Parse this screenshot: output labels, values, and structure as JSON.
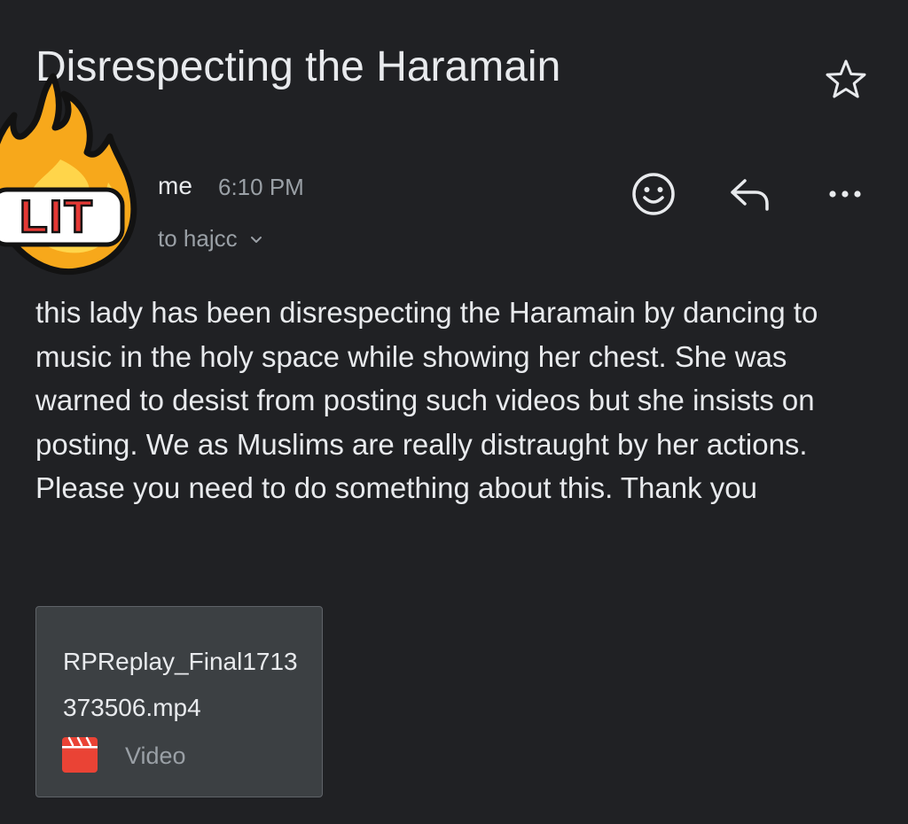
{
  "email": {
    "subject": "Disrespecting the Haramain",
    "sender": "me",
    "time": "6:10 PM",
    "recipients": "to hajcc",
    "body": "this lady has been disrespecting the Haramain by dancing to music in the holy space while showing her chest. She was warned to desist from posting such videos but she insists on posting. We as Muslims are really distraught by her actions. Please you need to do something about this. Thank you"
  },
  "attachment": {
    "filename": "RPReplay_Final1713373506.mp4",
    "type": "Video",
    "icon": "video-clapper-icon",
    "icon_color": "#ea4335"
  },
  "sticker": {
    "text": "LIT",
    "icon": "fire-icon"
  },
  "icons": {
    "star": "star-icon",
    "emoji": "emoji-reaction-icon",
    "reply": "reply-icon",
    "more": "more-options-icon"
  },
  "colors": {
    "background": "#202124",
    "text_primary": "#e8eaed",
    "text_secondary": "#9aa0a6",
    "attachment_bg": "#3c4043"
  }
}
